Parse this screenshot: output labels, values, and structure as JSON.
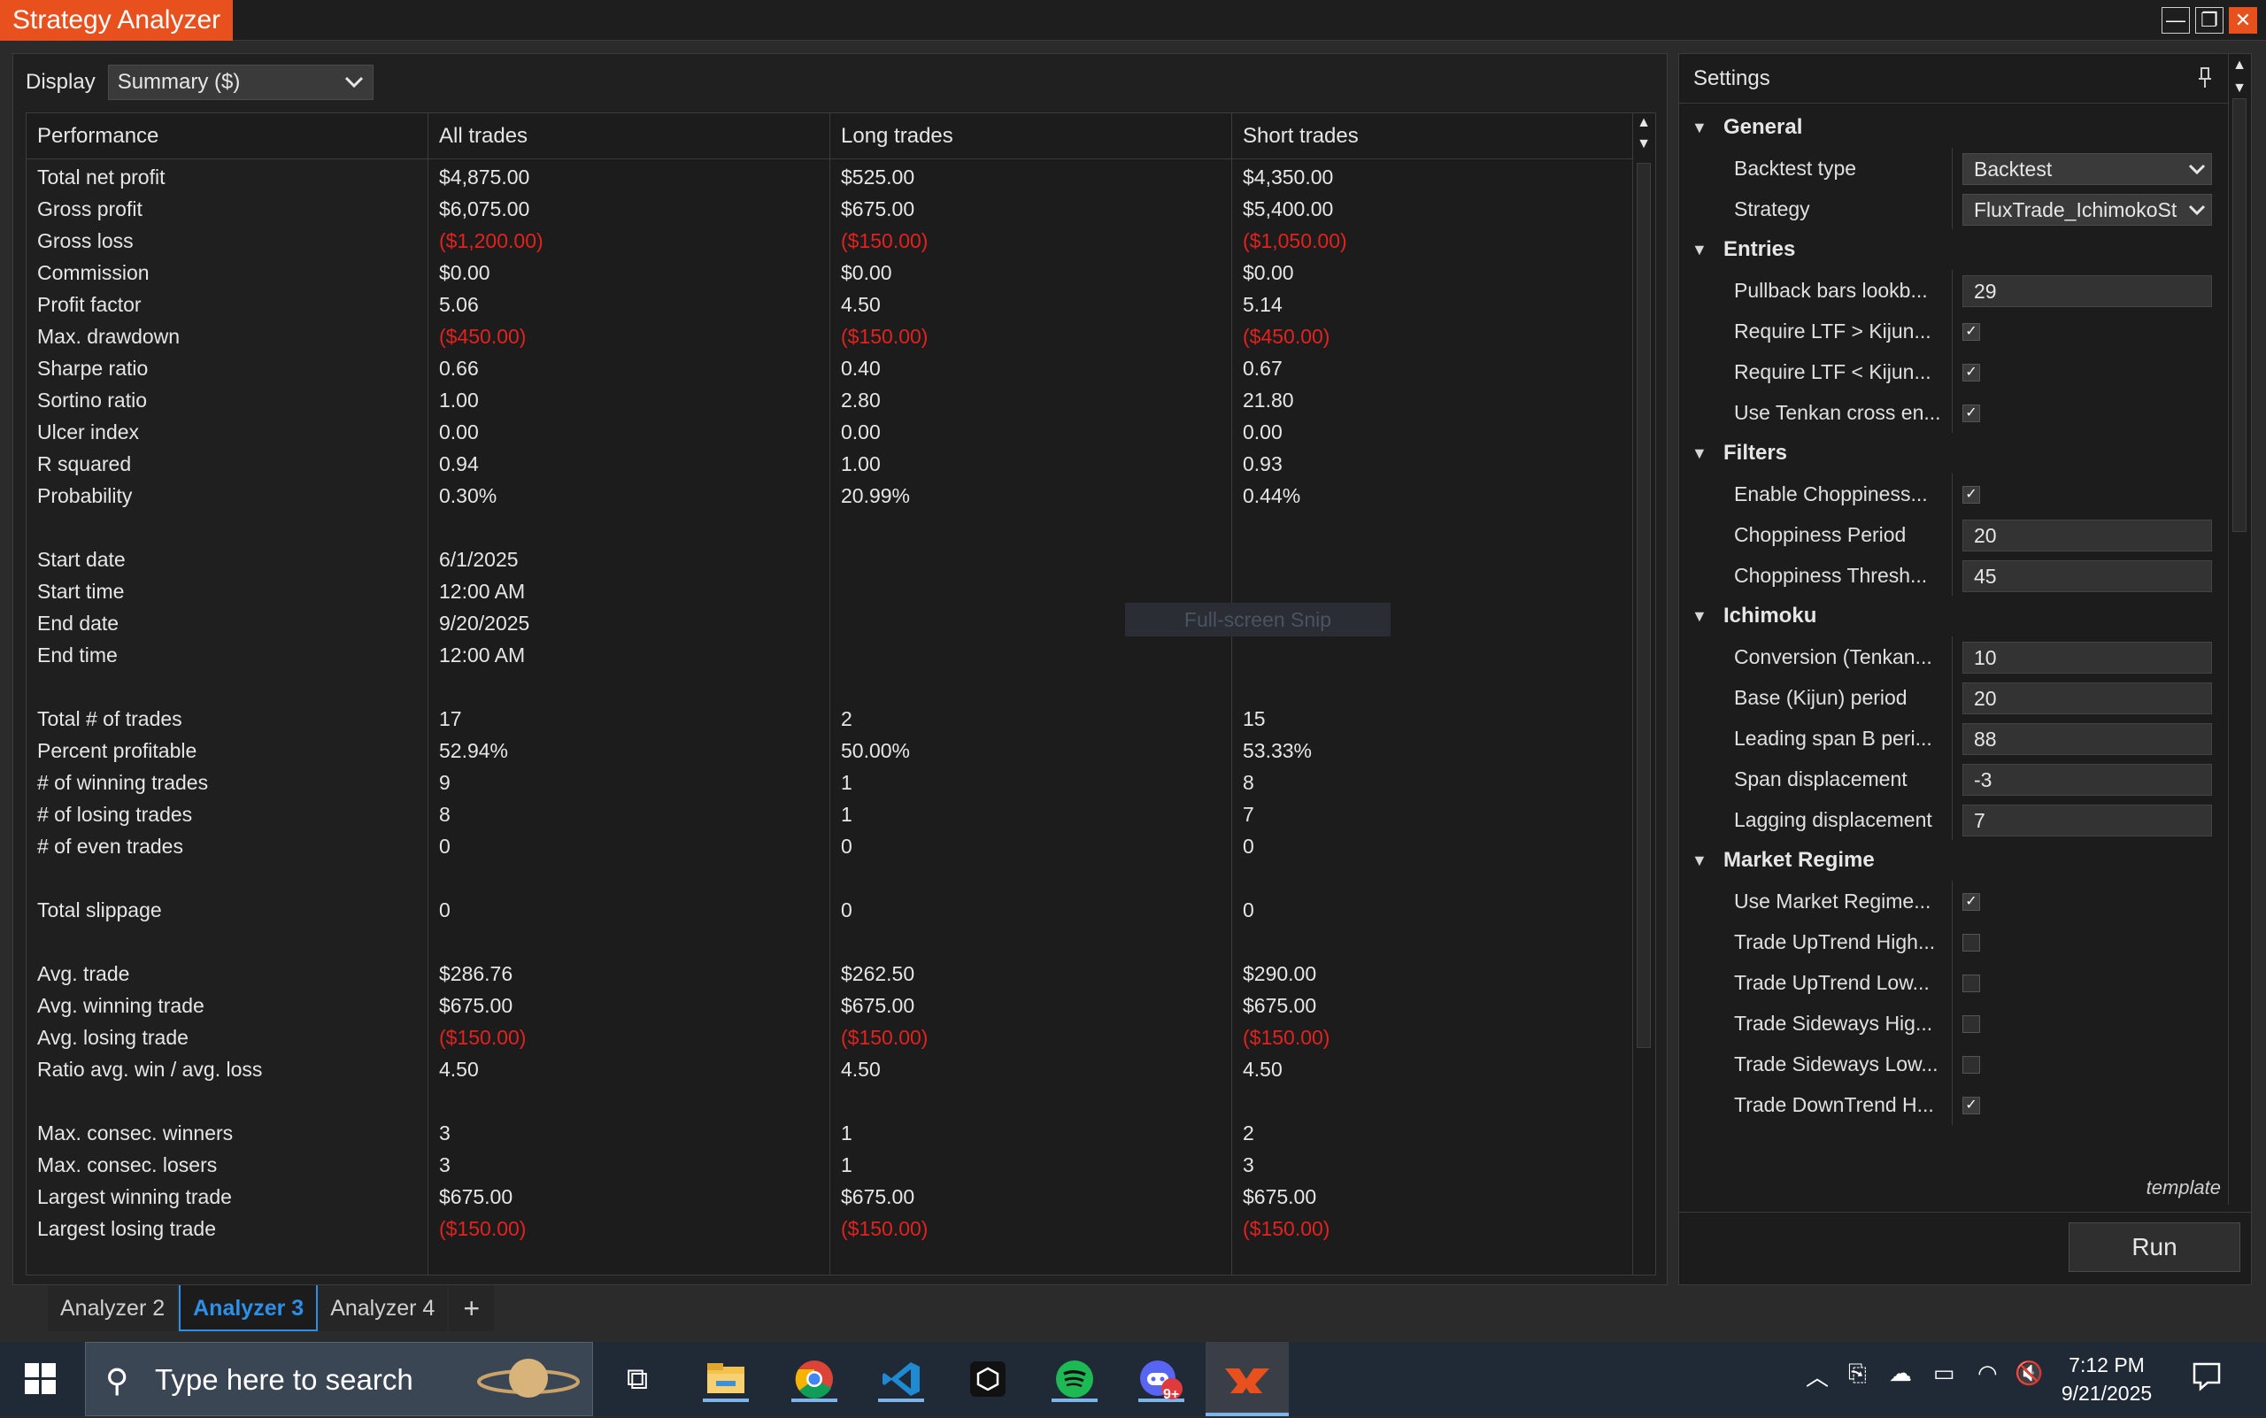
{
  "window": {
    "title": "Strategy Analyzer",
    "minimize": "—",
    "restore": "❐",
    "close": "✕"
  },
  "display": {
    "label": "Display",
    "value": "Summary ($)"
  },
  "grid": {
    "columns": [
      "Performance",
      "All trades",
      "Long trades",
      "Short trades"
    ],
    "rows": [
      {
        "label": "Total net profit",
        "all": "$4,875.00",
        "long": "$525.00",
        "short": "$4,350.00"
      },
      {
        "label": "Gross profit",
        "all": "$6,075.00",
        "long": "$675.00",
        "short": "$5,400.00"
      },
      {
        "label": "Gross loss",
        "all": "($1,200.00)",
        "long": "($150.00)",
        "short": "($1,050.00)",
        "neg": true
      },
      {
        "label": "Commission",
        "all": "$0.00",
        "long": "$0.00",
        "short": "$0.00"
      },
      {
        "label": "Profit factor",
        "all": "5.06",
        "long": "4.50",
        "short": "5.14"
      },
      {
        "label": "Max. drawdown",
        "all": "($450.00)",
        "long": "($150.00)",
        "short": "($450.00)",
        "neg": true
      },
      {
        "label": "Sharpe ratio",
        "all": "0.66",
        "long": "0.40",
        "short": "0.67"
      },
      {
        "label": "Sortino ratio",
        "all": "1.00",
        "long": "2.80",
        "short": "21.80"
      },
      {
        "label": "Ulcer index",
        "all": "0.00",
        "long": "0.00",
        "short": "0.00"
      },
      {
        "label": "R squared",
        "all": "0.94",
        "long": "1.00",
        "short": "0.93"
      },
      {
        "label": "Probability",
        "all": "0.30%",
        "long": "20.99%",
        "short": "0.44%"
      },
      {
        "blank": true
      },
      {
        "label": "Start date",
        "all": "6/1/2025",
        "long": "",
        "short": ""
      },
      {
        "label": "Start time",
        "all": "12:00 AM",
        "long": "",
        "short": ""
      },
      {
        "label": "End date",
        "all": "9/20/2025",
        "long": "",
        "short": ""
      },
      {
        "label": "End time",
        "all": "12:00 AM",
        "long": "",
        "short": ""
      },
      {
        "blank": true
      },
      {
        "label": "Total # of trades",
        "all": "17",
        "long": "2",
        "short": "15"
      },
      {
        "label": "Percent profitable",
        "all": "52.94%",
        "long": "50.00%",
        "short": "53.33%"
      },
      {
        "label": "# of winning trades",
        "all": "9",
        "long": "1",
        "short": "8"
      },
      {
        "label": "# of losing trades",
        "all": "8",
        "long": "1",
        "short": "7"
      },
      {
        "label": "# of even trades",
        "all": "0",
        "long": "0",
        "short": "0"
      },
      {
        "blank": true
      },
      {
        "label": "Total slippage",
        "all": "0",
        "long": "0",
        "short": "0"
      },
      {
        "blank": true
      },
      {
        "label": "Avg. trade",
        "all": "$286.76",
        "long": "$262.50",
        "short": "$290.00"
      },
      {
        "label": "Avg. winning trade",
        "all": "$675.00",
        "long": "$675.00",
        "short": "$675.00"
      },
      {
        "label": "Avg. losing trade",
        "all": "($150.00)",
        "long": "($150.00)",
        "short": "($150.00)",
        "neg": true
      },
      {
        "label": "Ratio avg. win / avg. loss",
        "all": "4.50",
        "long": "4.50",
        "short": "4.50"
      },
      {
        "blank": true
      },
      {
        "label": "Max. consec. winners",
        "all": "3",
        "long": "1",
        "short": "2"
      },
      {
        "label": "Max. consec. losers",
        "all": "3",
        "long": "1",
        "short": "3"
      },
      {
        "label": "Largest winning trade",
        "all": "$675.00",
        "long": "$675.00",
        "short": "$675.00"
      },
      {
        "label": "Largest losing trade",
        "all": "($150.00)",
        "long": "($150.00)",
        "short": "($150.00)",
        "neg": true
      }
    ]
  },
  "overlay": {
    "snip_label": "Full-screen Snip"
  },
  "tabs": {
    "items": [
      "Analyzer 2",
      "Analyzer 3",
      "Analyzer 4"
    ],
    "active": 1,
    "add": "+"
  },
  "settings": {
    "title": "Settings",
    "template_label": "template",
    "run_label": "Run",
    "sections": [
      {
        "name": "General",
        "props": [
          {
            "label": "Backtest type",
            "type": "dropdown",
            "value": "Backtest"
          },
          {
            "label": "Strategy",
            "type": "dropdown",
            "value": "FluxTrade_IchimokoSt"
          }
        ]
      },
      {
        "name": "Entries",
        "props": [
          {
            "label": "Pullback bars lookb...",
            "type": "text",
            "value": "29"
          },
          {
            "label": "Require LTF > Kijun...",
            "type": "check",
            "value": true
          },
          {
            "label": "Require LTF < Kijun...",
            "type": "check",
            "value": true
          },
          {
            "label": "Use Tenkan cross en...",
            "type": "check",
            "value": true
          }
        ]
      },
      {
        "name": "Filters",
        "props": [
          {
            "label": "Enable Choppiness...",
            "type": "check",
            "value": true
          },
          {
            "label": "Choppiness Period",
            "type": "text",
            "value": "20"
          },
          {
            "label": "Choppiness Thresh...",
            "type": "text",
            "value": "45"
          }
        ]
      },
      {
        "name": "Ichimoku",
        "props": [
          {
            "label": "Conversion (Tenkan...",
            "type": "text",
            "value": "10"
          },
          {
            "label": "Base (Kijun) period",
            "type": "text",
            "value": "20"
          },
          {
            "label": "Leading span B peri...",
            "type": "text",
            "value": "88"
          },
          {
            "label": "Span displacement",
            "type": "text",
            "value": "-3"
          },
          {
            "label": "Lagging displacement",
            "type": "text",
            "value": "7"
          }
        ]
      },
      {
        "name": "Market Regime",
        "props": [
          {
            "label": "Use Market Regime...",
            "type": "check",
            "value": true
          },
          {
            "label": "Trade UpTrend High...",
            "type": "check",
            "value": false
          },
          {
            "label": "Trade UpTrend Low...",
            "type": "check",
            "value": false
          },
          {
            "label": "Trade Sideways Hig...",
            "type": "check",
            "value": false
          },
          {
            "label": "Trade Sideways Low...",
            "type": "check",
            "value": false
          },
          {
            "label": "Trade DownTrend H...",
            "type": "check",
            "value": true
          }
        ]
      }
    ]
  },
  "taskbar": {
    "search_placeholder": "Type here to search",
    "time": "7:12 PM",
    "date": "9/21/2025",
    "discord_badge": "9+",
    "colors": {
      "background": "#1f2a36",
      "accent": "#e8501e",
      "negative": "#e3221e",
      "tab_active": "#2e8fe6"
    }
  }
}
